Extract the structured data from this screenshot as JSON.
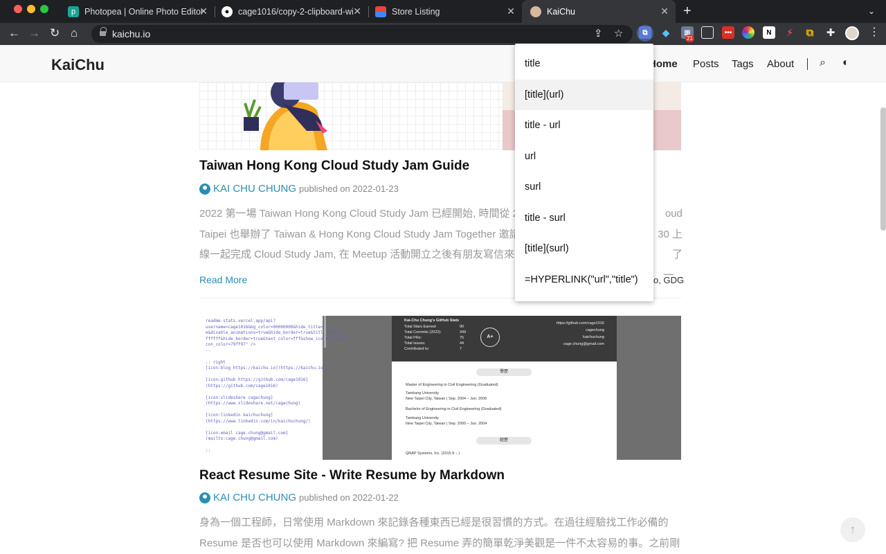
{
  "browser": {
    "tabs": [
      {
        "label": "Photopea | Online Photo Editor",
        "icon": "photopea-icon",
        "color": "#18a497"
      },
      {
        "label": "cage1016/copy-2-clipboard-wi",
        "icon": "github-icon",
        "color": "#ffffff"
      },
      {
        "label": "Store Listing",
        "icon": "chrome-webstore-icon",
        "color": "#e8453c"
      },
      {
        "label": "KaiChu",
        "icon": "kaichu-avatar-icon",
        "color": "#d9b99b"
      }
    ],
    "active_tab": 3,
    "url": "kaichu.io",
    "extension_badge": "21"
  },
  "site": {
    "title": "KaiChu",
    "nav": [
      "Home",
      "Posts",
      "Tags",
      "About"
    ]
  },
  "posts": [
    {
      "title": "Taiwan Hong Kong Cloud Study Jam Guide",
      "author": "KAI CHU CHUNG",
      "published": "published on 2022-01-23",
      "excerpt_lines": [
        "2022 第一場 Taiwan Hong Kong Cloud Study Jam 已經開始, 時間從 2",
        "Taipei 也舉辦了 Taiwan & Hong Kong Cloud Study Jam Together 邀請",
        "線一起完成 Cloud Study Jam, 在 Meetup 活動開立之後有朋友寫信來"
      ],
      "excerpt_right": [
        "oud",
        "30 上",
        "了一..."
      ],
      "read_more": "Read More",
      "tags_partial": "o, GDG"
    },
    {
      "title": "React Resume Site - Write Resume by Markdown",
      "author": "KAI CHU CHUNG",
      "published": "published on 2022-01-22",
      "excerpt_lines": [
        "身為一個工程師，日常使用 Markdown 來記錄各種東西已經是很習慣的方式。在過往經驗找工作必備的",
        "Resume 是否也可以使用 Markdown 來編寫? 把 Resume 弄的簡單乾淨美觀是一件不太容易的事。之前剛"
      ]
    }
  ],
  "thumbnail2": {
    "code_text": "readme-stats.vercel.app/api?\nusername=cage1016&bg_color=00000000&hide_title=fals\ne&disable_animations=true&hide_border=true&title_color=\nffffff&hide_border=true&text_color=fff&show_icons=true&i\ncon_color=79ff97\" />\n--\n\n:: right\n[icon:blog https://kaichu.io](https://kaichu.io)\n\n[icon:github https://github.com/cage1016]\n(https://github.com/cage1016)\n\n[icon:slideshare cagechung]\n(https://www.slideshare.net/cagechung)\n\n[icon:linkedin kaichuchung]\n(https://www.linkedin.com/in/kaichuchung/)\n\n[icon:email cage.chung@gmail.com]\n(mailto:cage.chung@gmail.com)\n\n::",
    "stats_title": "Kai-Chu Chung's GitHub Stats",
    "stats": [
      {
        "label": "Total Stars Earned:",
        "value": "90"
      },
      {
        "label": "Total Commits (2022):",
        "value": "349"
      },
      {
        "label": "Total PRs:",
        "value": "75"
      },
      {
        "label": "Total Issues:",
        "value": "44"
      },
      {
        "label": "Contributed to:",
        "value": "7"
      }
    ],
    "grade": "A+",
    "links": [
      "https://github.com/cage1016",
      "cagechung",
      "kaichuchung",
      "cage.chung@gmail.com"
    ],
    "section_education": "學歷",
    "edu1_degree": "Master of Engineering in Civil Engineering (Graduated)",
    "edu1_school": "Tamkang University",
    "edu1_detail": "New Taipei City, Taiwan | Sep. 2004 – Jun. 2006",
    "edu2_degree": "Bachelor of Engineering in Civil Engineering (Graduated)",
    "edu2_school": "Tamkang University",
    "edu2_detail": "New Taipei City, Taiwan | Sep. 2000 – Jun. 2004",
    "section_experience": "經歷",
    "exp1": "QNAP Systems, Inc. (2015.9 – )"
  },
  "popup": {
    "items": [
      "title",
      "[title](url)",
      "title - url",
      "url",
      "surl",
      "title - surl",
      "[title](surl)",
      "=HYPERLINK(\"url\",\"title\")"
    ],
    "hover_index": 1
  },
  "colors": {
    "link": "#2a8db4",
    "chrome_dark": "#1f2023",
    "chrome_toolbar": "#35363a"
  }
}
